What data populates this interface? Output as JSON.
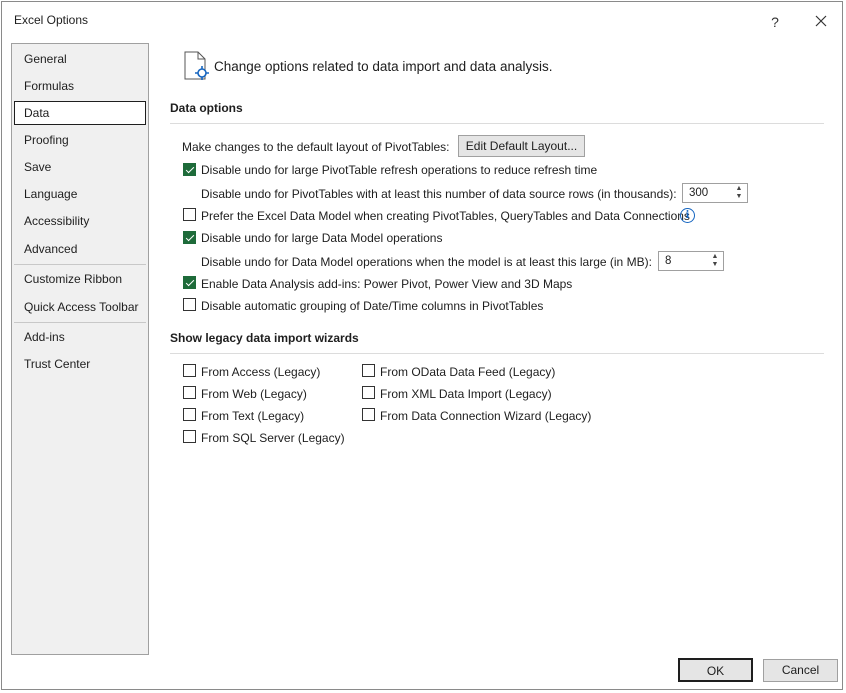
{
  "window": {
    "title": "Excel Options",
    "help_glyph": "?",
    "close_glyph": "✕"
  },
  "sidebar": {
    "items": [
      {
        "label": "General"
      },
      {
        "label": "Formulas"
      },
      {
        "label": "Data",
        "selected": true
      },
      {
        "label": "Proofing"
      },
      {
        "label": "Save"
      },
      {
        "label": "Language"
      },
      {
        "label": "Accessibility"
      },
      {
        "label": "Advanced"
      },
      {
        "label": "Customize Ribbon"
      },
      {
        "label": "Quick Access Toolbar"
      },
      {
        "label": "Add-ins"
      },
      {
        "label": "Trust Center"
      }
    ]
  },
  "header": {
    "text": "Change options related to data import and data analysis.",
    "icon": "document-gear-icon"
  },
  "data_options": {
    "title": "Data options",
    "pivot_layout_label": "Make changes to the default layout of PivotTables:",
    "edit_layout_button": "Edit Default Layout...",
    "disable_undo_pivot": {
      "label": "Disable undo for large PivotTable refresh operations to reduce refresh time",
      "checked": true
    },
    "undo_rows_label": "Disable undo for PivotTables with at least this number of data source rows (in thousands):",
    "undo_rows_value": "300",
    "prefer_data_model": {
      "label": "Prefer the Excel Data Model when creating PivotTables, QueryTables and Data Connections",
      "checked": false
    },
    "disable_undo_model": {
      "label": "Disable undo for large Data Model operations",
      "checked": true
    },
    "undo_model_label": "Disable undo for Data Model operations when the model is at least this large (in MB):",
    "undo_model_value": "8",
    "enable_addins": {
      "label": "Enable Data Analysis add-ins: Power Pivot, Power View and 3D Maps",
      "checked": true
    },
    "disable_grouping": {
      "label": "Disable automatic grouping of Date/Time columns in PivotTables",
      "checked": false
    }
  },
  "legacy": {
    "title": "Show legacy data import wizards",
    "left": [
      {
        "label": "From Access (Legacy)",
        "checked": false
      },
      {
        "label": "From Web (Legacy)",
        "checked": false
      },
      {
        "label": "From Text (Legacy)",
        "checked": false
      },
      {
        "label": "From SQL Server (Legacy)",
        "checked": false
      }
    ],
    "right": [
      {
        "label": "From OData Data Feed (Legacy)",
        "checked": false
      },
      {
        "label": "From XML Data Import (Legacy)",
        "checked": false
      },
      {
        "label": "From Data Connection Wizard (Legacy)",
        "checked": false
      }
    ]
  },
  "footer": {
    "ok": "OK",
    "cancel": "Cancel"
  },
  "colors": {
    "checkbox_checked": "#1e6b3a",
    "info_icon": "#1565c0"
  }
}
